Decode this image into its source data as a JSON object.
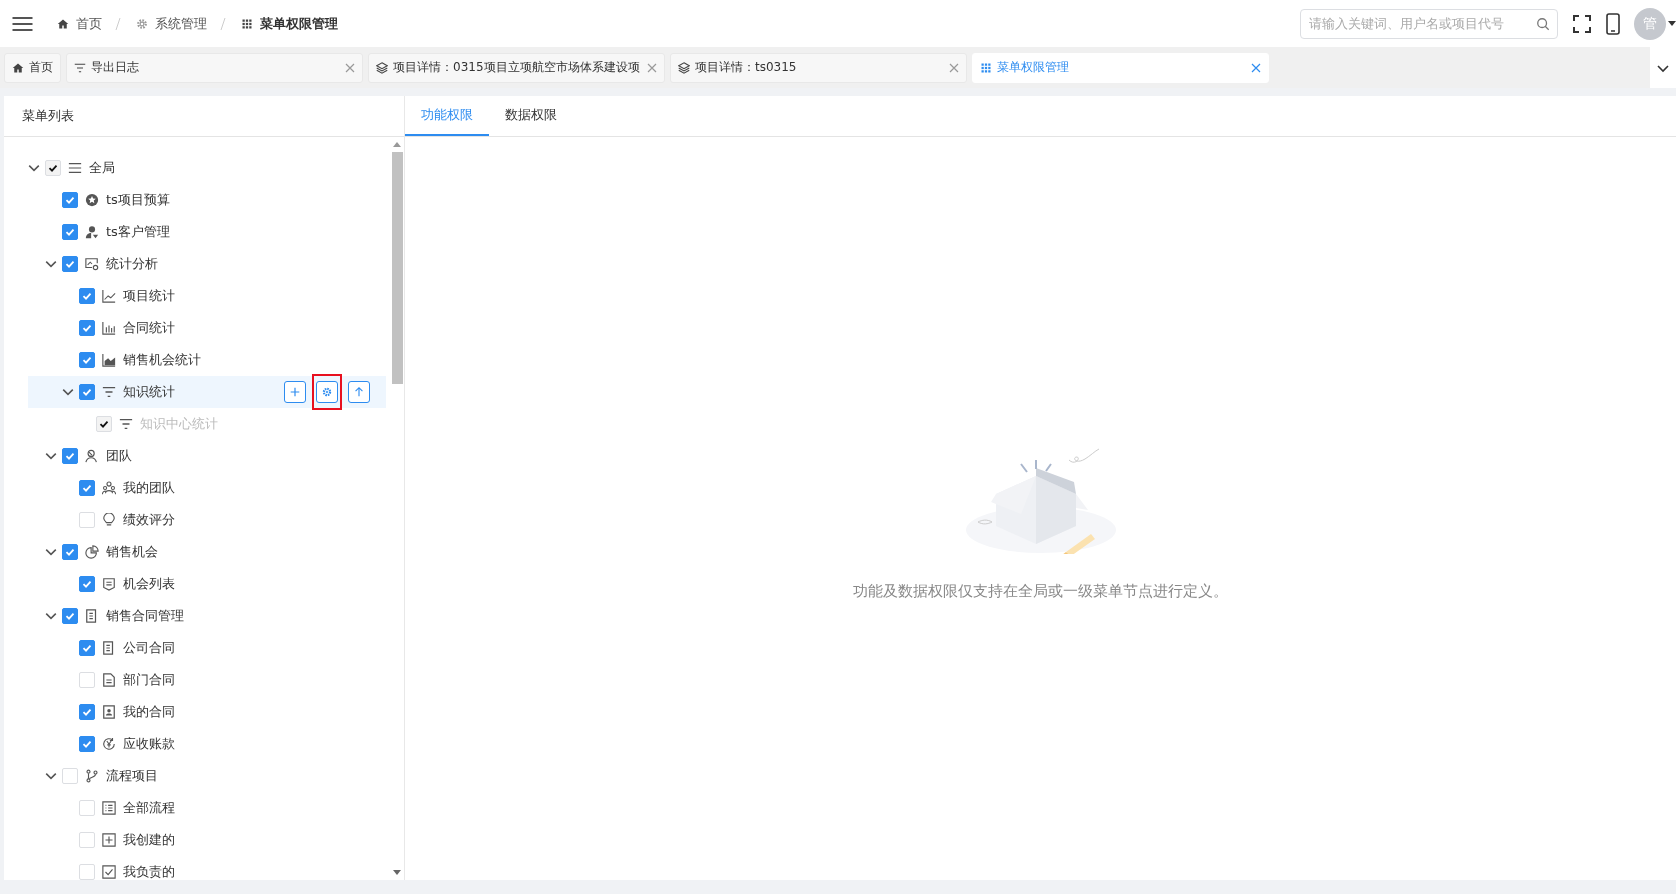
{
  "header": {
    "breadcrumbs": [
      {
        "label": "首页",
        "kind": "home",
        "current": false
      },
      {
        "label": "系统管理",
        "kind": "gear",
        "current": false
      },
      {
        "label": "菜单权限管理",
        "kind": "grid",
        "current": true
      }
    ],
    "search": {
      "placeholder": "请输入关键词、用户名或项目代号"
    },
    "avatar": {
      "label": "管"
    }
  },
  "tabs": [
    {
      "label": "首页",
      "kind": "home",
      "closable": false,
      "selected": false
    },
    {
      "label": "导出日志",
      "kind": "filter",
      "closable": true,
      "selected": false
    },
    {
      "label": "项目详情：0315项目立项航空市场体系建设项",
      "kind": "layers",
      "closable": true,
      "selected": false
    },
    {
      "label": "项目详情：ts0315",
      "kind": "layers",
      "closable": true,
      "selected": false
    },
    {
      "label": "菜单权限管理",
      "kind": "grid",
      "closable": true,
      "selected": true
    }
  ],
  "menu_panel": {
    "title": "菜单列表",
    "tree": [
      {
        "label": "全局",
        "kind": "lines",
        "checked": true,
        "disabled": true,
        "expanded": true,
        "children": [
          {
            "label": "ts项目预算",
            "kind": "star",
            "checked": true,
            "disabled": false
          },
          {
            "label": "ts客户管理",
            "kind": "user",
            "checked": true,
            "disabled": false
          },
          {
            "label": "统计分析",
            "kind": "monitor",
            "checked": true,
            "disabled": false,
            "expanded": true,
            "children": [
              {
                "label": "项目统计",
                "kind": "line",
                "checked": true,
                "disabled": false
              },
              {
                "label": "合同统计",
                "kind": "bars",
                "checked": true,
                "disabled": false
              },
              {
                "label": "销售机会统计",
                "kind": "area",
                "checked": true,
                "disabled": false
              },
              {
                "label": "知识统计",
                "kind": "filter",
                "checked": true,
                "disabled": false,
                "expanded": true,
                "hovered": true,
                "actions": [
                  {
                    "kind": "add",
                    "highlighted": false
                  },
                  {
                    "kind": "settings",
                    "highlighted": true
                  },
                  {
                    "kind": "up",
                    "highlighted": false
                  }
                ],
                "children": [
                  {
                    "label": "知识中心统计",
                    "kind": "filter",
                    "checked": true,
                    "disabled": true
                  }
                ]
              }
            ]
          },
          {
            "label": "团队",
            "kind": "person",
            "checked": true,
            "disabled": false,
            "expanded": true,
            "children": [
              {
                "label": "我的团队",
                "kind": "team",
                "checked": true,
                "disabled": false
              },
              {
                "label": "绩效评分",
                "kind": "bulb",
                "checked": false,
                "disabled": false
              }
            ]
          },
          {
            "label": "销售机会",
            "kind": "pie",
            "checked": true,
            "disabled": false,
            "expanded": true,
            "children": [
              {
                "label": "机会列表",
                "kind": "shield",
                "checked": true,
                "disabled": false
              }
            ]
          },
          {
            "label": "销售合同管理",
            "kind": "doc",
            "checked": true,
            "disabled": false,
            "expanded": true,
            "children": [
              {
                "label": "公司合同",
                "kind": "doc",
                "checked": true,
                "disabled": false
              },
              {
                "label": "部门合同",
                "kind": "file",
                "checked": false,
                "disabled": false
              },
              {
                "label": "我的合同",
                "kind": "contact",
                "checked": true,
                "disabled": false
              },
              {
                "label": "应收账款",
                "kind": "yen",
                "checked": true,
                "disabled": false
              }
            ]
          },
          {
            "label": "流程项目",
            "kind": "branch",
            "checked": false,
            "disabled": false,
            "expanded": true,
            "children": [
              {
                "label": "全部流程",
                "kind": "list",
                "checked": false,
                "disabled": false
              },
              {
                "label": "我创建的",
                "kind": "plusbox",
                "checked": false,
                "disabled": false
              },
              {
                "label": "我负责的",
                "kind": "checkbox",
                "checked": false,
                "disabled": false
              }
            ]
          }
        ]
      }
    ]
  },
  "permission_panel": {
    "tabs": [
      {
        "label": "功能权限",
        "selected": true
      },
      {
        "label": "数据权限",
        "selected": false
      }
    ],
    "empty_message": "功能及数据权限仅支持在全局或一级菜单节点进行定义。"
  }
}
